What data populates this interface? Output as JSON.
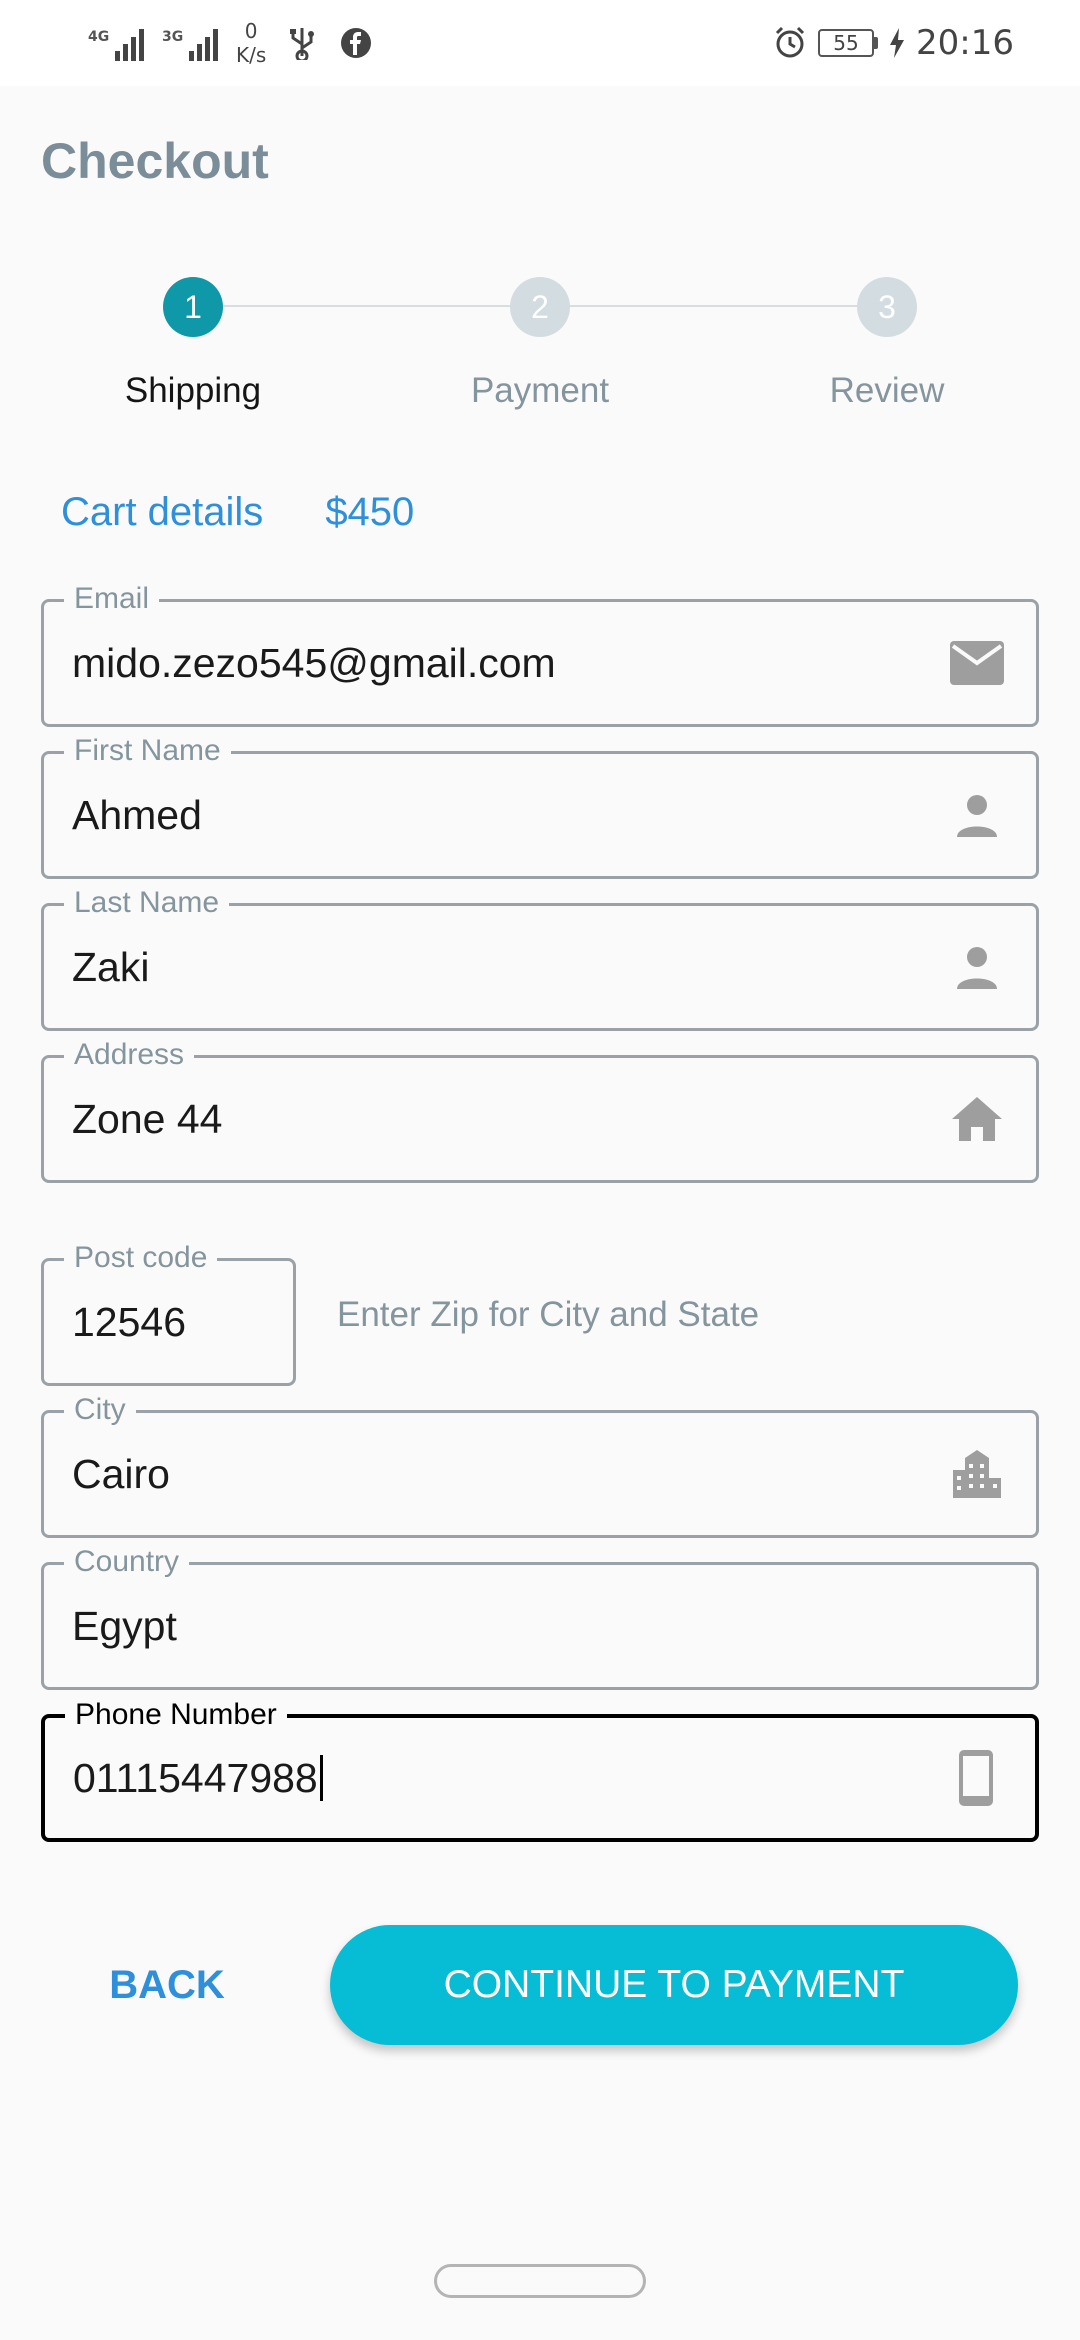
{
  "status_bar": {
    "network_1": "4G",
    "network_2": "3G",
    "speed_value": "0",
    "speed_unit": "K/s",
    "battery": "55",
    "time": "20:16"
  },
  "page": {
    "title": "Checkout"
  },
  "stepper": {
    "steps": [
      {
        "number": "1",
        "label": "Shipping",
        "active": true
      },
      {
        "number": "2",
        "label": "Payment",
        "active": false
      },
      {
        "number": "3",
        "label": "Review",
        "active": false
      }
    ]
  },
  "cart": {
    "label": "Cart details",
    "total": "$450"
  },
  "form": {
    "email": {
      "label": "Email",
      "value": "mido.zezo545@gmail.com",
      "icon": "mail-icon"
    },
    "first_name": {
      "label": "First Name",
      "value": "Ahmed",
      "icon": "person-icon"
    },
    "last_name": {
      "label": "Last Name",
      "value": "Zaki",
      "icon": "person-icon"
    },
    "address": {
      "label": "Address",
      "value": "Zone 44",
      "icon": "home-icon"
    },
    "post_code": {
      "label": "Post code",
      "value": "12546"
    },
    "zip_hint": "Enter Zip for City and State",
    "city": {
      "label": "City",
      "value": "Cairo",
      "icon": "city-icon"
    },
    "country": {
      "label": "Country",
      "value": "Egypt"
    },
    "phone": {
      "label": "Phone Number",
      "value": "01115447988",
      "icon": "phone-icon"
    }
  },
  "actions": {
    "back": "BACK",
    "continue": "CONTINUE TO PAYMENT"
  },
  "colors": {
    "accent": "#0e98a8",
    "button": "#07bcd5",
    "link": "#2e8fdb",
    "title": "#7b8d98"
  }
}
